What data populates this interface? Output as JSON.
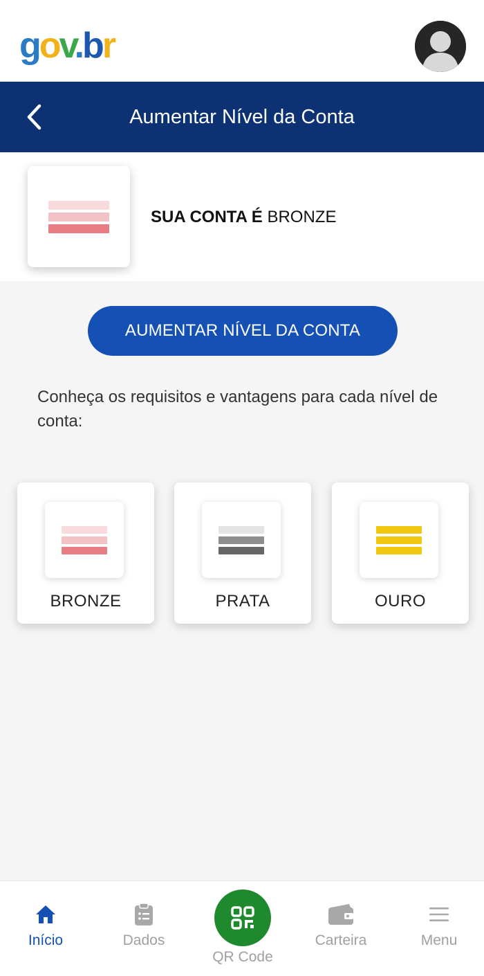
{
  "header": {
    "logo": {
      "g": "g",
      "o": "o",
      "v": "v",
      "dot": ".",
      "b": "b",
      "r": "r"
    },
    "avatar_icon": "user-avatar"
  },
  "titlebar": {
    "back_icon": "chevron-left-icon",
    "title": "Aumentar Nível da Conta"
  },
  "account": {
    "current_level_icon": "bronze-level-icon",
    "status_prefix": "SUA CONTA É",
    "status_level": "BRONZE"
  },
  "upgrade_button": {
    "label": "AUMENTAR NÍVEL DA CONTA"
  },
  "intro_text": "Conheça os requisitos e vantagens para cada nível de conta:",
  "tiers": [
    {
      "label": "BRONZE",
      "icon": "bronze-level-icon",
      "colors": [
        "#f8dadd",
        "#f2c2c5",
        "#e77c83"
      ]
    },
    {
      "label": "PRATA",
      "icon": "silver-level-icon",
      "colors": [
        "#e3e3e3",
        "#8e8e8e",
        "#666666"
      ]
    },
    {
      "label": "OURO",
      "icon": "gold-level-icon",
      "colors": [
        "#f2c70f",
        "#f2c70f",
        "#f2c70f"
      ]
    }
  ],
  "bottom_nav": {
    "items": [
      {
        "label": "Início",
        "icon": "home-icon",
        "active": true
      },
      {
        "label": "Dados",
        "icon": "clipboard-icon",
        "active": false
      },
      {
        "label": "QR Code",
        "icon": "qr-code-icon",
        "active": false
      },
      {
        "label": "Carteira",
        "icon": "wallet-icon",
        "active": false
      },
      {
        "label": "Menu",
        "icon": "hamburger-menu-icon",
        "active": false
      }
    ]
  },
  "colors": {
    "primary_blue": "#1551b4",
    "header_navy": "#0c3273",
    "qr_green": "#1f8a2d",
    "inactive_gray": "#a0a0a0"
  }
}
